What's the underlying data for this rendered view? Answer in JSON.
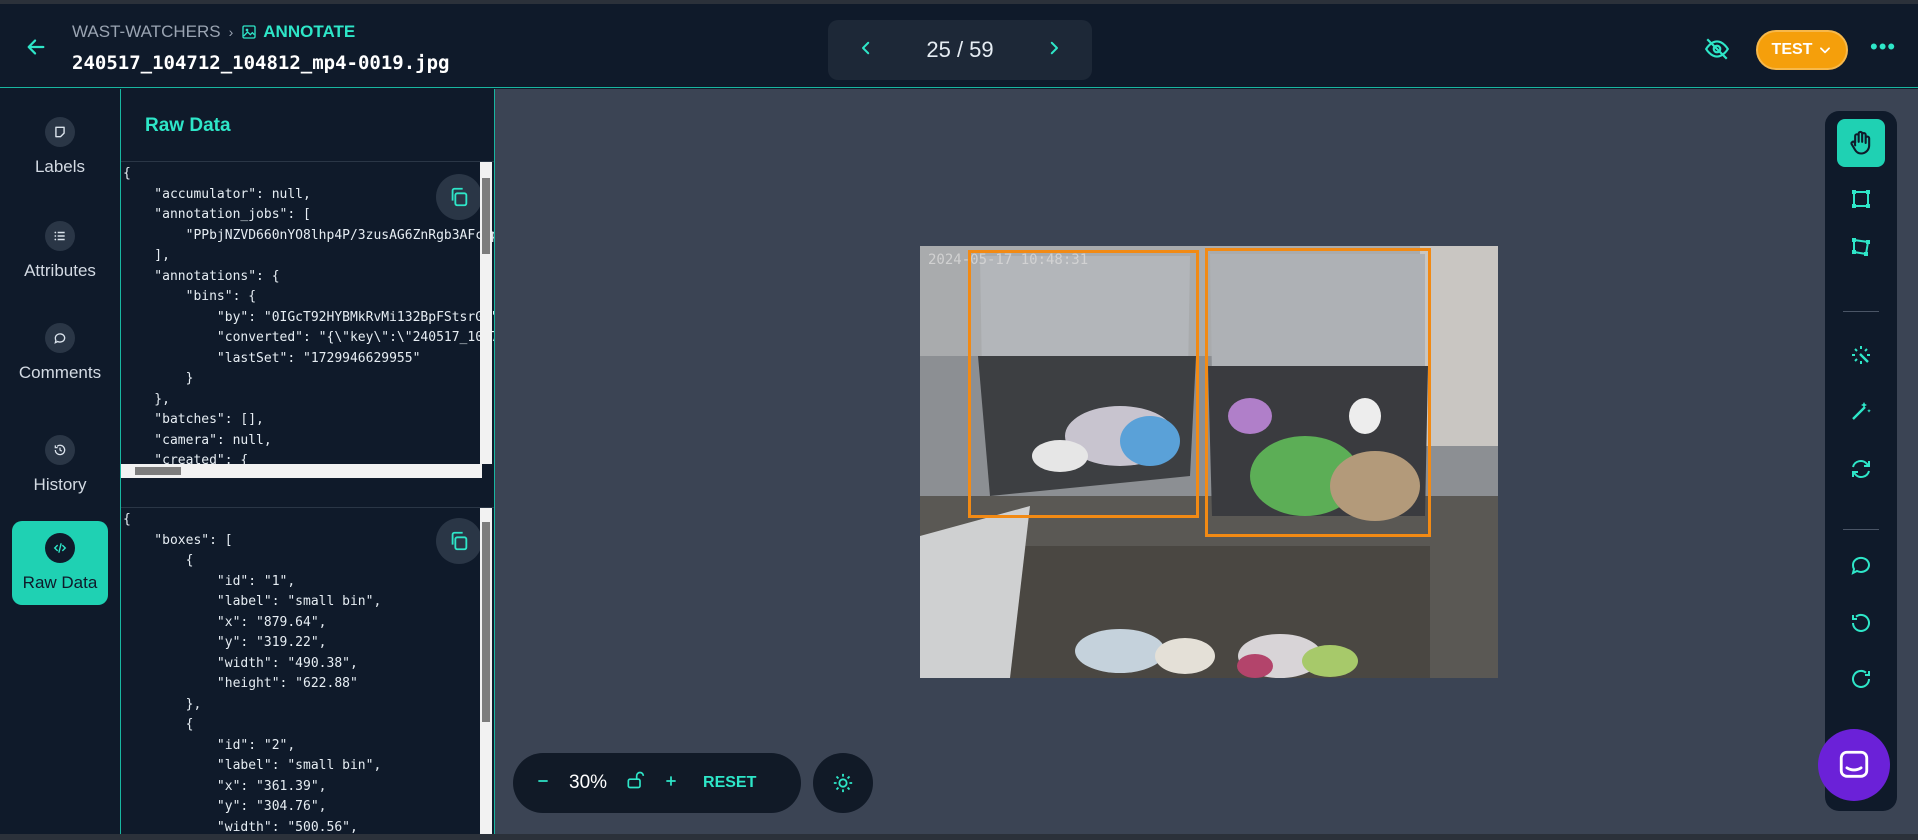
{
  "header": {
    "breadcrumb_project": "WAST-WATCHERS",
    "breadcrumb_mode": "ANNOTATE",
    "filename": "240517_104712_104812_mp4-0019.jpg",
    "pager": {
      "current": "25",
      "total": "59",
      "display": "25 / 59"
    },
    "env_label": "TEST"
  },
  "sidebar": {
    "items": [
      {
        "label": "Labels",
        "icon": "label-icon",
        "active": false
      },
      {
        "label": "Attributes",
        "icon": "list-icon",
        "active": false
      },
      {
        "label": "Comments",
        "icon": "comment-icon",
        "active": false
      },
      {
        "label": "History",
        "icon": "history-icon",
        "active": false
      },
      {
        "label": "Raw Data",
        "icon": "code-icon",
        "active": true
      }
    ]
  },
  "raw_data": {
    "title": "Raw Data",
    "document_json": "{\n    \"accumulator\": null,\n    \"annotation_jobs\": [\n        \"PPbjNZVD660nYO8lhp4P/3zusAG6ZnRgb3AFcyp\n    ],\n    \"annotations\": {\n        \"bins\": {\n            \"by\": \"0IGcT92HYBMkRvMi132BpFStsrG2\"\n            \"converted\": \"{\\\"key\\\":\\\"240517_1047\n            \"lastSet\": \"1729946629955\"\n        }\n    },\n    \"batches\": [],\n    \"camera\": null,\n    \"created\": {",
    "boxes_json": "{\n    \"boxes\": [\n        {\n            \"id\": \"1\",\n            \"label\": \"small bin\",\n            \"x\": \"879.64\",\n            \"y\": \"319.22\",\n            \"width\": \"490.38\",\n            \"height\": \"622.88\"\n        },\n        {\n            \"id\": \"2\",\n            \"label\": \"small bin\",\n            \"x\": \"361.39\",\n            \"y\": \"304.76\",\n            \"width\": \"500.56\","
  },
  "image": {
    "timestamp": "2024-05-17 10:48:31",
    "boxes": [
      {
        "id": "1",
        "label": "small bin"
      },
      {
        "id": "2",
        "label": "small bin"
      }
    ]
  },
  "zoom": {
    "value": "30%",
    "reset_label": "RESET"
  },
  "tools": [
    "pan-icon",
    "bbox-icon",
    "polygon-icon",
    "magic-select-icon",
    "magic-wand-icon",
    "sync-icon",
    "comment-icon",
    "undo-icon",
    "redo-icon"
  ],
  "colors": {
    "accent": "#2ee6c8",
    "box": "#f28a14",
    "env": "#f59f0b",
    "chat": "#6b21d8"
  }
}
